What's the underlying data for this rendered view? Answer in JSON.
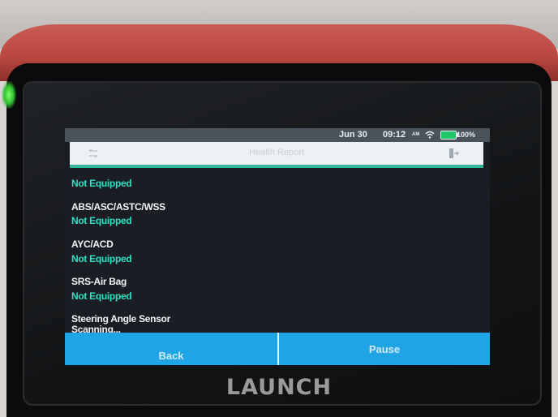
{
  "status_bar": {
    "date": "Jun 30",
    "time": "09:12",
    "am_pm": "AM",
    "battery": "100%",
    "battery_color": "#21c66b"
  },
  "header": {
    "title": "Health Report",
    "back_icon": "back-arrow-icon",
    "exit_icon": "exit-icon",
    "accent_color": "#32b49a"
  },
  "report": {
    "items": [
      {
        "name": "",
        "status": "Not Equipped"
      },
      {
        "name": "ABS/ASC/ASTC/WSS",
        "status": "Not Equipped"
      },
      {
        "name": "AYC/ACD",
        "status": "Not Equipped"
      },
      {
        "name": "SRS-Air Bag",
        "status": "Not Equipped"
      },
      {
        "name": "Steering Angle Sensor",
        "status": "Scanning..."
      }
    ],
    "status_color": "#2ee0c2"
  },
  "footer": {
    "back_label": "Back",
    "pause_label": "Pause",
    "bar_color": "#1fa4e6"
  },
  "device": {
    "brand": "LAUNCH"
  }
}
